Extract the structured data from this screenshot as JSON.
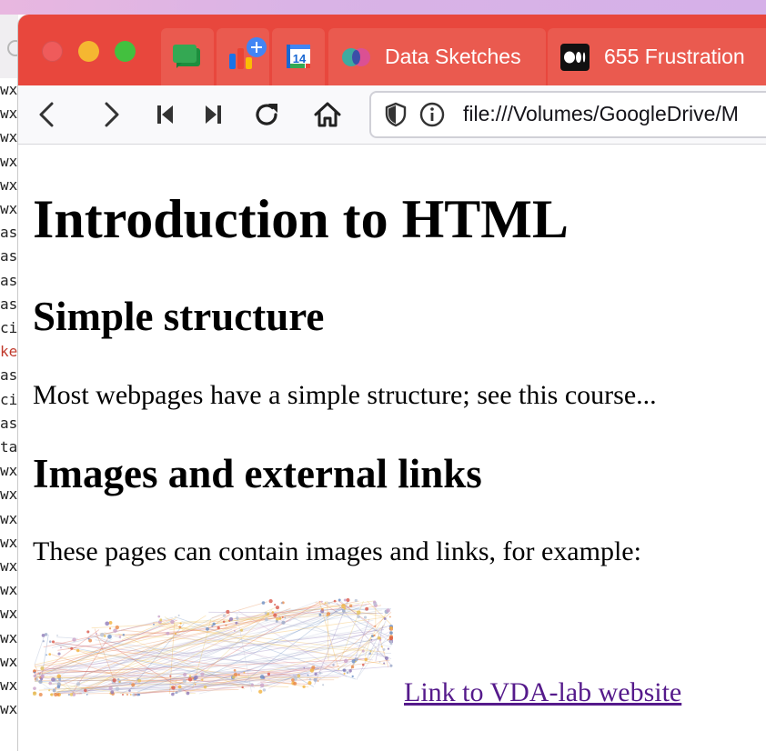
{
  "colors": {
    "tabbar": "#e8473d",
    "active_tab": "#ea5a4f",
    "link_visited": "#551a8b",
    "terminal_highlight": "#c0392b"
  },
  "background_terminal": {
    "lines": [
      "wx",
      "wx",
      "wx",
      "wx",
      "wx",
      "wx",
      "as",
      "as",
      "as",
      "as",
      "ci",
      "ke",
      "as",
      "ci",
      "as",
      "ta",
      "wx",
      "wx",
      "wx",
      "wx",
      "wx",
      "wx",
      "wx",
      "wx",
      "wx",
      "wx",
      "wx"
    ]
  },
  "browser": {
    "pinned_tabs": [
      {
        "icon": "google-chat-icon"
      },
      {
        "icon": "google-contacts-icon"
      },
      {
        "icon": "google-calendar-icon",
        "label": "14"
      }
    ],
    "tabs": [
      {
        "icon": "data-sketches-icon",
        "title": "Data Sketches"
      },
      {
        "icon": "medium-icon",
        "title": "655 Frustration"
      }
    ],
    "toolbar": {
      "url": "file:///Volumes/GoogleDrive/M"
    }
  },
  "page": {
    "title": "Introduction to HTML",
    "section1_heading": "Simple structure",
    "section1_text": "Most webpages have a simple structure; see this course...",
    "section2_heading": "Images and external links",
    "section2_text": "These pages can contain images and links, for example:",
    "link_text": "Link to VDA-lab website"
  }
}
